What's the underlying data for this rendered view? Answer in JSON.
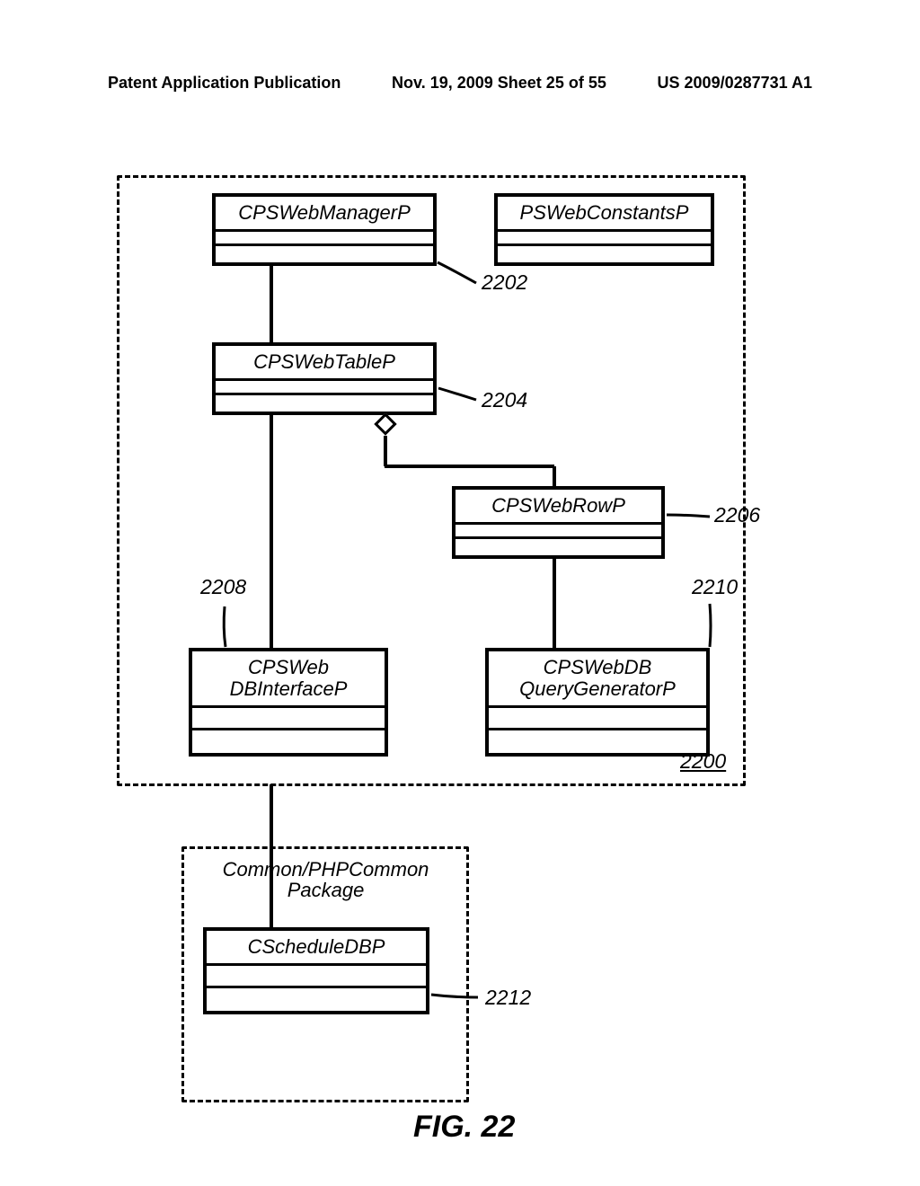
{
  "header": {
    "left": "Patent Application Publication",
    "mid": "Nov. 19, 2009  Sheet 25 of 55",
    "right": "US 2009/0287731 A1"
  },
  "boxes": {
    "manager": "CPSWebManagerP",
    "constants": "PSWebConstantsP",
    "table": "CPSWebTableP",
    "row": "CPSWebRowP",
    "dbinterface_l1": "CPSWeb",
    "dbinterface_l2": "DBInterfaceP",
    "querygen_l1": "CPSWebDB",
    "querygen_l2": "QueryGeneratorP",
    "scheduledb": "CScheduleDBP"
  },
  "refs": {
    "r2202": "2202",
    "r2204": "2204",
    "r2206": "2206",
    "r2208": "2208",
    "r2210": "2210",
    "r2212": "2212",
    "main_pkg": "2200"
  },
  "pkg_label_l1": "Common/PHPCommon",
  "pkg_label_l2": "Package",
  "fig_caption": "FIG.  22"
}
